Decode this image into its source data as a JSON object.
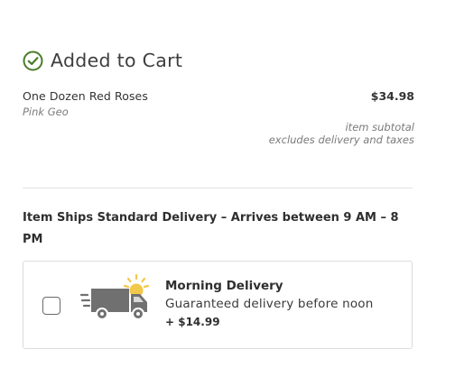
{
  "header": {
    "title": "Added to Cart",
    "icon": "check-circle-icon",
    "icon_color": "#4a7c2a"
  },
  "item": {
    "name": "One Dozen Red Roses",
    "variant": "Pink Geo",
    "price": "$34.98",
    "subtotal_label": "item subtotal",
    "subtotal_note": "excludes delivery and taxes"
  },
  "shipping": {
    "heading": "Item Ships Standard Delivery – Arrives between 9 AM – 8 PM"
  },
  "delivery_option": {
    "checked": false,
    "icon": "delivery-truck-sun-icon",
    "title": "Morning Delivery",
    "description": "Guaranteed delivery before noon",
    "price": "+ $14.99",
    "sun_color": "#f2c84b",
    "truck_color": "#707070"
  }
}
